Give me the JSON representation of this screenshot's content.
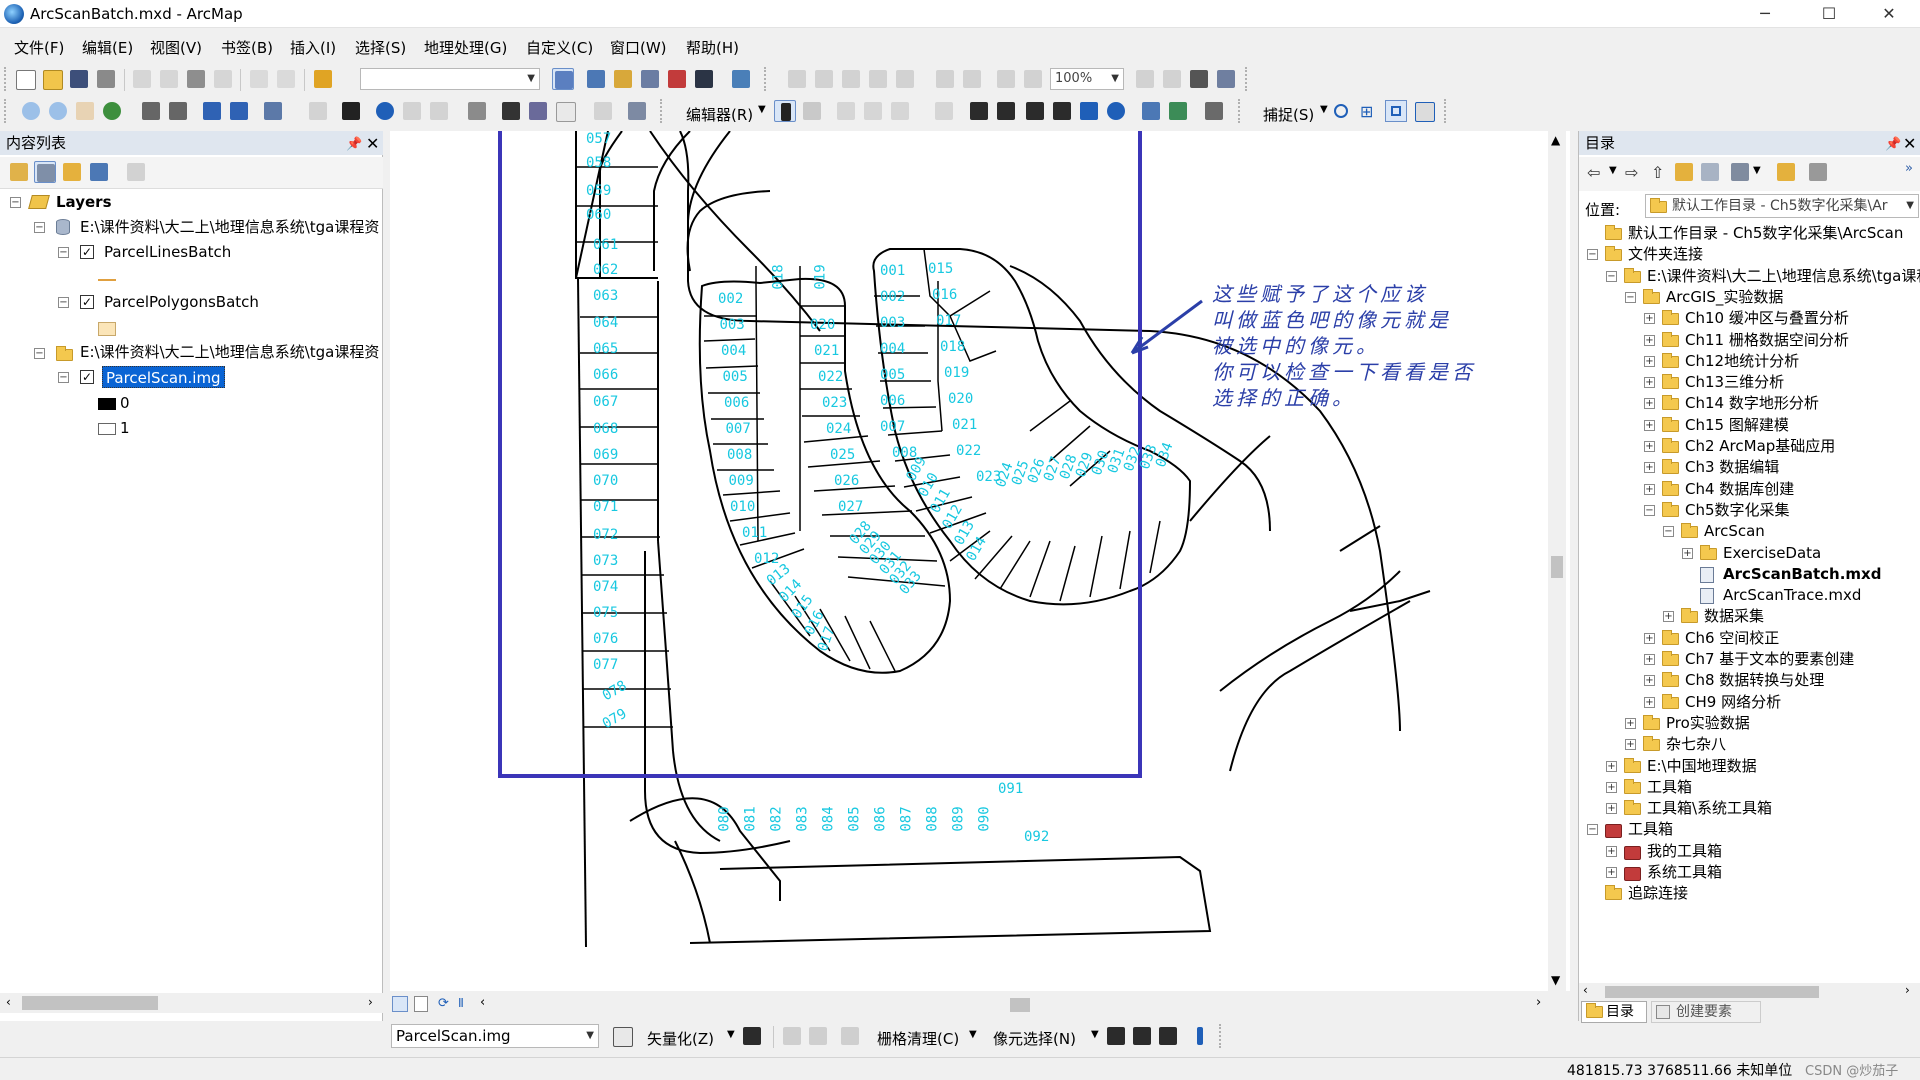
{
  "window": {
    "title": "ArcScanBatch.mxd - ArcMap",
    "minimize": "─",
    "maximize": "☐",
    "close": "✕"
  },
  "menu": [
    "文件(F)",
    "编辑(E)",
    "视图(V)",
    "书签(B)",
    "插入(I)",
    "选择(S)",
    "地理处理(G)",
    "自定义(C)",
    "窗口(W)",
    "帮助(H)"
  ],
  "toolbar": {
    "scale_value": "",
    "zoom_value": "100%",
    "editor_label": "编辑器(R)",
    "snap_label": "捕捉(S)"
  },
  "toc": {
    "title": "内容列表",
    "root": "Layers",
    "items": [
      {
        "label": "E:\\课件资料\\大二上\\地理信息系统\\tga课程资"
      },
      {
        "label": "ParcelLinesBatch",
        "checked": true
      },
      {
        "label": "ParcelPolygonsBatch",
        "checked": true
      },
      {
        "label": "E:\\课件资料\\大二上\\地理信息系统\\tga课程资"
      },
      {
        "label": "ParcelScan.img",
        "checked": true
      }
    ],
    "legend0": "0",
    "legend1": "1"
  },
  "map": {
    "annotation": [
      "这些赋予了这个应该",
      "叫做蓝色吧的像元就是",
      "被选中的像元。",
      "你可以检查一下看看是否",
      "选择的正确。"
    ],
    "colors": {
      "selection": "#3b35b8",
      "labels": "#18c8e0",
      "annotation": "#2b3fa8"
    }
  },
  "parcel_labels": {
    "column": [
      "057",
      "058",
      "059",
      "060",
      "061",
      "062",
      "063",
      "064",
      "065",
      "066",
      "067",
      "068",
      "069",
      "070",
      "071",
      "072",
      "073",
      "074",
      "075",
      "076",
      "077",
      "078",
      "079"
    ],
    "block_a_left": [
      "002",
      "003",
      "004",
      "005",
      "006",
      "007",
      "008",
      "009",
      "010",
      "011",
      "012",
      "013",
      "014",
      "015",
      "016",
      "017"
    ],
    "block_a_right": [
      "018",
      "019",
      "020",
      "021",
      "022",
      "023",
      "024",
      "025",
      "026",
      "027",
      "028",
      "029",
      "030",
      "031",
      "032",
      "033"
    ],
    "block_b_left": [
      "001",
      "002",
      "003",
      "004",
      "005",
      "006",
      "007",
      "008",
      "009",
      "010",
      "011",
      "012",
      "013",
      "014"
    ],
    "block_b_right": [
      "015",
      "016",
      "017",
      "018",
      "019",
      "020",
      "021",
      "022",
      "023",
      "024",
      "025",
      "026",
      "027",
      "028",
      "029",
      "030",
      "031",
      "032",
      "033",
      "034"
    ],
    "bottom_row": [
      "080",
      "081",
      "082",
      "083",
      "084",
      "085",
      "086",
      "087",
      "088",
      "089",
      "090",
      "091",
      "092"
    ]
  },
  "catalog": {
    "title": "目录",
    "location_label": "位置:",
    "location_value": "默认工作目录 - Ch5数字化采集\\Ar",
    "rows": [
      {
        "label": "默认工作目录 - Ch5数字化采集\\ArcScan",
        "type": "folder",
        "bold": false
      },
      {
        "label": "文件夹连接",
        "type": "folder",
        "bold": false
      },
      {
        "label": "E:\\课件资料\\大二上\\地理信息系统\\tga课程",
        "type": "folder",
        "bold": false
      },
      {
        "label": "ArcGIS_实验数据",
        "type": "folder",
        "bold": false
      },
      {
        "label": "Ch10 缓冲区与叠置分析",
        "type": "folder",
        "bold": false
      },
      {
        "label": "Ch11 栅格数据空间分析",
        "type": "folder",
        "bold": false
      },
      {
        "label": "Ch12地统计分析",
        "type": "folder",
        "bold": false
      },
      {
        "label": "Ch13三维分析",
        "type": "folder",
        "bold": false
      },
      {
        "label": "Ch14 数字地形分析",
        "type": "folder",
        "bold": false
      },
      {
        "label": "Ch15 图解建模",
        "type": "folder",
        "bold": false
      },
      {
        "label": "Ch2  ArcMap基础应用",
        "type": "folder",
        "bold": false
      },
      {
        "label": "Ch3 数据编辑",
        "type": "folder",
        "bold": false
      },
      {
        "label": "Ch4 数据库创建",
        "type": "folder",
        "bold": false
      },
      {
        "label": "Ch5数字化采集",
        "type": "folder",
        "bold": false
      },
      {
        "label": "ArcScan",
        "type": "folder",
        "bold": false
      },
      {
        "label": "ExerciseData",
        "type": "folder",
        "bold": false
      },
      {
        "label": "ArcScanBatch.mxd",
        "type": "mxd",
        "bold": true
      },
      {
        "label": "ArcScanTrace.mxd",
        "type": "mxd",
        "bold": false
      },
      {
        "label": "数据采集",
        "type": "folder",
        "bold": false
      },
      {
        "label": "Ch6 空间校正",
        "type": "folder",
        "bold": false
      },
      {
        "label": "Ch7 基于文本的要素创建",
        "type": "folder",
        "bold": false
      },
      {
        "label": "Ch8 数据转换与处理",
        "type": "folder",
        "bold": false
      },
      {
        "label": "CH9 网络分析",
        "type": "folder",
        "bold": false
      },
      {
        "label": "Pro实验数据",
        "type": "folder",
        "bold": false
      },
      {
        "label": "杂七杂八",
        "type": "folder",
        "bold": false
      },
      {
        "label": "E:\\中国地理数据",
        "type": "folder",
        "bold": false
      },
      {
        "label": "工具箱",
        "type": "folder",
        "bold": false
      },
      {
        "label": "工具箱\\系统工具箱",
        "type": "folder",
        "bold": false
      },
      {
        "label": "工具箱",
        "type": "toolbox",
        "bold": false
      },
      {
        "label": "我的工具箱",
        "type": "toolbox",
        "bold": false
      },
      {
        "label": "系统工具箱",
        "type": "toolbox",
        "bold": false
      },
      {
        "label": "追踪连接",
        "type": "folder",
        "bold": false
      }
    ],
    "tab_catalog": "目录",
    "tab_create": "创建要素"
  },
  "arcscan": {
    "layer_value": "ParcelScan.img",
    "vectorize": "矢量化(Z)",
    "raster_cleanup": "栅格清理(C)",
    "cell_selection": "像元选择(N)"
  },
  "status": {
    "coords": "481815.73  3768511.66 未知单位",
    "watermark": "CSDN @炒茄子"
  }
}
